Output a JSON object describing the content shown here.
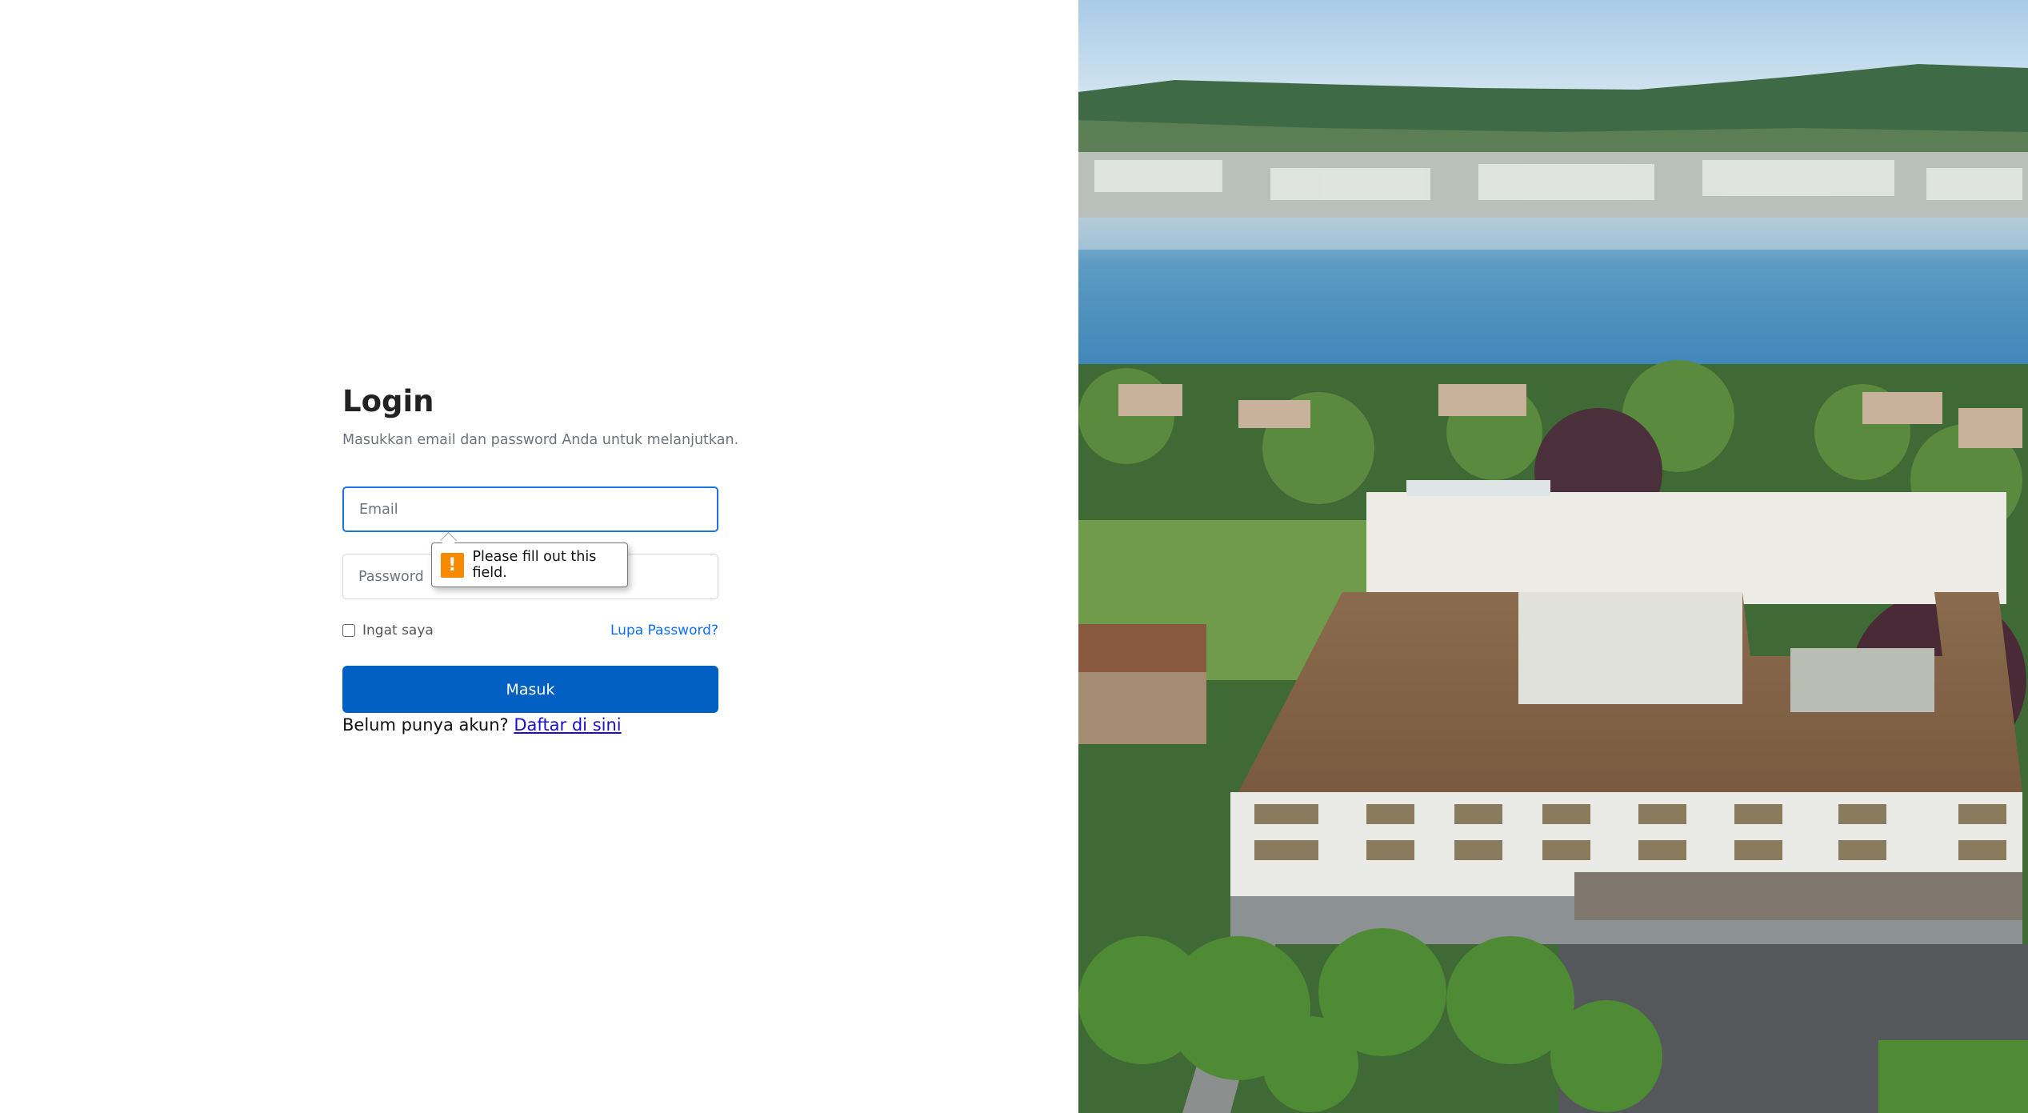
{
  "login": {
    "title": "Login",
    "subtitle": "Masukkan email dan password Anda untuk melanjutkan.",
    "email_placeholder": "Email",
    "password_placeholder": "Password",
    "remember_label": "Ingat saya",
    "forgot_link": "Lupa Password?",
    "submit_label": "Masuk",
    "register_prompt": "Belum punya akun?",
    "register_link": "Daftar di sini"
  },
  "validation_tooltip": {
    "icon": "warning-icon",
    "message": "Please fill out this field."
  },
  "colors": {
    "primary_button": "#0260c2",
    "link": "#0d6efd",
    "focus_border": "#1a73e8",
    "warning": "#f68a00"
  }
}
